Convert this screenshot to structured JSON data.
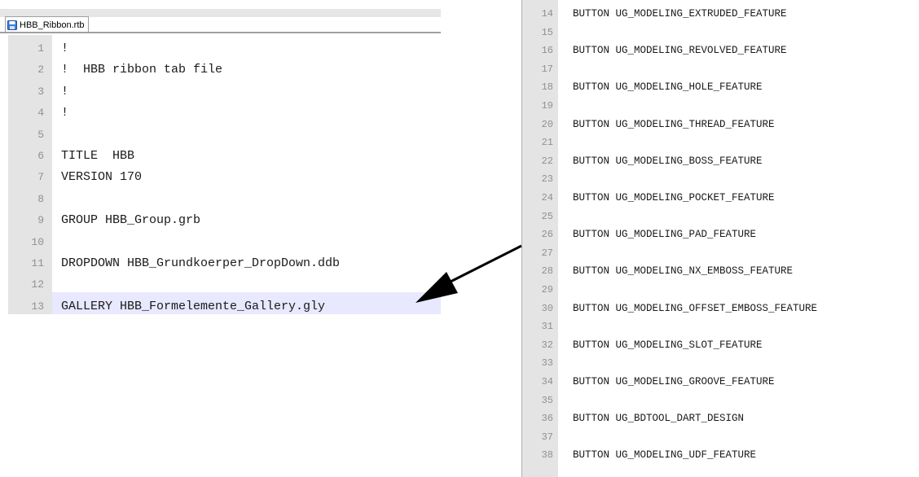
{
  "tab": {
    "label": "HBB_Ribbon.rtb",
    "icon": "save-icon"
  },
  "left_lines": [
    {
      "n": "1",
      "text": "!"
    },
    {
      "n": "2",
      "text": "!  HBB ribbon tab file"
    },
    {
      "n": "3",
      "text": "!"
    },
    {
      "n": "4",
      "text": "!"
    },
    {
      "n": "5",
      "text": ""
    },
    {
      "n": "6",
      "text": "TITLE  HBB"
    },
    {
      "n": "7",
      "text": "VERSION 170"
    },
    {
      "n": "8",
      "text": ""
    },
    {
      "n": "9",
      "text": "GROUP HBB_Group.grb"
    },
    {
      "n": "10",
      "text": ""
    },
    {
      "n": "11",
      "text": "DROPDOWN HBB_Grundkoerper_DropDown.ddb"
    },
    {
      "n": "12",
      "text": ""
    },
    {
      "n": "13",
      "text": "GALLERY HBB_Formelemente_Gallery.gly"
    }
  ],
  "right_lines": [
    {
      "n": "14",
      "text": "BUTTON UG_MODELING_EXTRUDED_FEATURE"
    },
    {
      "n": "15",
      "text": ""
    },
    {
      "n": "16",
      "text": "BUTTON UG_MODELING_REVOLVED_FEATURE"
    },
    {
      "n": "17",
      "text": ""
    },
    {
      "n": "18",
      "text": "BUTTON UG_MODELING_HOLE_FEATURE"
    },
    {
      "n": "19",
      "text": ""
    },
    {
      "n": "20",
      "text": "BUTTON UG_MODELING_THREAD_FEATURE"
    },
    {
      "n": "21",
      "text": ""
    },
    {
      "n": "22",
      "text": "BUTTON UG_MODELING_BOSS_FEATURE"
    },
    {
      "n": "23",
      "text": ""
    },
    {
      "n": "24",
      "text": "BUTTON UG_MODELING_POCKET_FEATURE"
    },
    {
      "n": "25",
      "text": ""
    },
    {
      "n": "26",
      "text": "BUTTON UG_MODELING_PAD_FEATURE"
    },
    {
      "n": "27",
      "text": ""
    },
    {
      "n": "28",
      "text": "BUTTON UG_MODELING_NX_EMBOSS_FEATURE"
    },
    {
      "n": "29",
      "text": ""
    },
    {
      "n": "30",
      "text": "BUTTON UG_MODELING_OFFSET_EMBOSS_FEATURE"
    },
    {
      "n": "31",
      "text": ""
    },
    {
      "n": "32",
      "text": "BUTTON UG_MODELING_SLOT_FEATURE"
    },
    {
      "n": "33",
      "text": ""
    },
    {
      "n": "34",
      "text": "BUTTON UG_MODELING_GROOVE_FEATURE"
    },
    {
      "n": "35",
      "text": ""
    },
    {
      "n": "36",
      "text": "BUTTON UG_BDTOOL_DART_DESIGN"
    },
    {
      "n": "37",
      "text": ""
    },
    {
      "n": "38",
      "text": "BUTTON UG_MODELING_UDF_FEATURE"
    }
  ],
  "colors": {
    "gutter": "#e4e4e4",
    "highlight": "#e8e8ff",
    "line_number": "#909090"
  }
}
